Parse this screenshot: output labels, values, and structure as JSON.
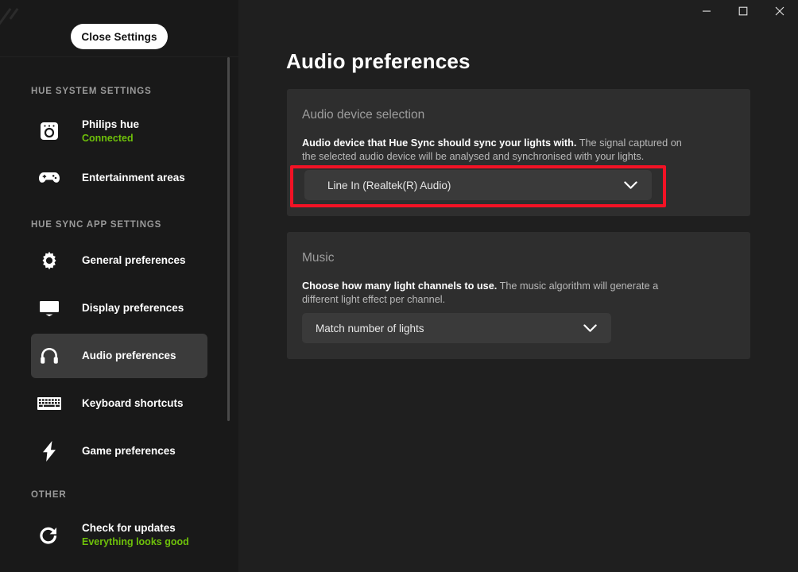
{
  "window": {
    "minimize_label": "—",
    "maximize_label": "□",
    "close_label": "✕"
  },
  "sidebar": {
    "close_settings_label": "Close Settings",
    "sections": [
      {
        "label": "HUE SYSTEM SETTINGS"
      },
      {
        "label": "HUE SYNC APP SETTINGS"
      },
      {
        "label": "OTHER"
      }
    ],
    "items": [
      {
        "icon": "hue-bridge-icon",
        "label": "Philips hue",
        "status": "Connected",
        "active": false
      },
      {
        "icon": "gamepad-icon",
        "label": "Entertainment areas",
        "status": "",
        "active": false
      },
      {
        "icon": "gear-icon",
        "label": "General preferences",
        "status": "",
        "active": false
      },
      {
        "icon": "monitor-icon",
        "label": "Display preferences",
        "status": "",
        "active": false
      },
      {
        "icon": "headphones-icon",
        "label": "Audio preferences",
        "status": "",
        "active": true
      },
      {
        "icon": "keyboard-icon",
        "label": "Keyboard shortcuts",
        "status": "",
        "active": false
      },
      {
        "icon": "lightning-bolt-icon",
        "label": "Game preferences",
        "status": "",
        "active": false
      },
      {
        "icon": "refresh-icon",
        "label": "Check for updates",
        "status": "Everything looks good",
        "active": false
      }
    ]
  },
  "main": {
    "page_title": "Audio preferences",
    "cards": [
      {
        "title": "Audio device selection",
        "desc_bold": "Audio device that Hue Sync should sync your lights with.",
        "desc_rest": " The signal captured on the selected audio device will be analysed and synchronised with your lights.",
        "select_value": "Line In (Realtek(R) Audio)"
      },
      {
        "title": "Music",
        "desc_bold": "Choose how many light channels to use.",
        "desc_rest": " The music algorithm will generate a different light effect per channel.",
        "select_value": "Match number of lights"
      }
    ]
  },
  "annotation": {
    "highlight_color": "#f31225"
  }
}
